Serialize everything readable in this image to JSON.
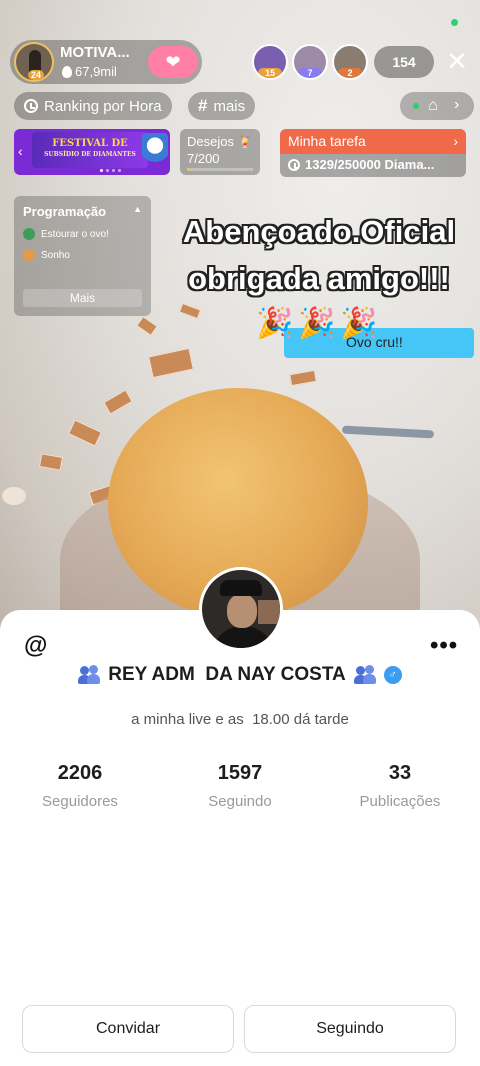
{
  "host": {
    "name": "MOTIVA...",
    "level": "24",
    "popularity": "67,9mil"
  },
  "viewers": [
    {
      "level": "15",
      "badge_color": "#e8a23a"
    },
    {
      "level": "7",
      "badge_color": "#8a7cf0"
    },
    {
      "level": "2",
      "badge_color": "#e0783c"
    }
  ],
  "viewer_count": "154",
  "chips": {
    "ranking": "Ranking por Hora",
    "more": "mais"
  },
  "banner": {
    "title": "FESTIVAL DE",
    "subtitle": "SUBSÍDIO DE DIAMANTES"
  },
  "wishes": {
    "label": "Desejos",
    "count": "7/200",
    "progress": 0.035
  },
  "task": {
    "title": "Minha tarefa",
    "progress_text": "1329/250000 Diama..."
  },
  "schedule": {
    "title": "Programação",
    "items": [
      "Estourar o ovo!",
      "Sonho"
    ],
    "more_label": "Mais"
  },
  "overlay_text": {
    "line1": "Abençoado.Oficial",
    "line2": "obrigada amigo!!!"
  },
  "chat_bubble": "Ovo cru!!",
  "profile": {
    "name": "REY ADM  DA NAY COSTA",
    "bio": "a minha live e as  18.00 dá tarde",
    "stats": [
      {
        "value": "2206",
        "label": "Seguidores"
      },
      {
        "value": "1597",
        "label": "Seguindo"
      },
      {
        "value": "33",
        "label": "Publicações"
      }
    ],
    "buttons": {
      "invite": "Convidar",
      "following": "Seguindo"
    }
  },
  "colors": {
    "task_header": "#f06a4a",
    "chat_bubble": "#45c6f6",
    "follow_heart": "#ff7fa6",
    "banner": "#7a2bd6"
  }
}
